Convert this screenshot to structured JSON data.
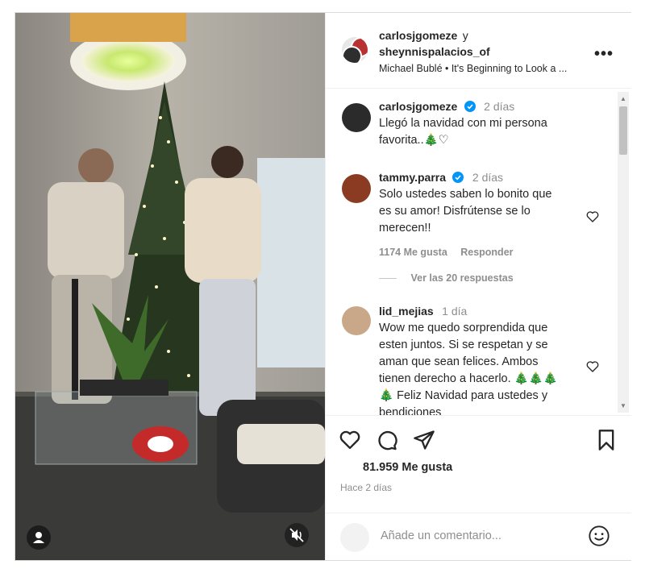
{
  "header": {
    "user1": "carlosjgomeze",
    "connector": "y",
    "user2": "sheynnispalacios_of",
    "audio": "Michael Bublé • It's Beginning to Look a ..."
  },
  "comments": [
    {
      "user": "carlosjgomeze",
      "time": "2 días",
      "lines": [
        "Llegó la navidad con mi persona",
        "favorita..🎄♡"
      ],
      "verified": true
    },
    {
      "user": "tammy.parra",
      "time": "2 días",
      "lines": [
        "Solo ustedes saben lo bonito que",
        "es su amor! Disfrútense se lo",
        "merecen!!"
      ],
      "verified": true,
      "likes": "1174 Me gusta",
      "reply": "Responder",
      "view_replies": "Ver las 20 respuestas"
    },
    {
      "user": "lid_mejias",
      "time": "1 día",
      "lines": [
        "Wow me quedo sorprendida que",
        "esten juntos. Si se respetan y se",
        "aman que sean felices. Ambos",
        "tienen derecho a hacerlo. 🎄🎄🎄",
        "🎄 Feliz Navidad para ustedes y",
        "bendiciones"
      ],
      "verified": false
    }
  ],
  "post": {
    "likes": "81.959 Me gusta",
    "date": "Hace 2 días",
    "comment_placeholder": "Añade un comentario..."
  },
  "colors": {
    "verified": "#0095f6",
    "text": "#262626",
    "muted": "#8e8e8e",
    "border": "#dbdbdb"
  },
  "icons": [
    "more-options-icon",
    "heart-icon",
    "comment-icon",
    "share-icon",
    "bookmark-icon",
    "emoji-icon",
    "user-tag-icon",
    "muted-speaker-icon",
    "verified-badge-icon"
  ]
}
